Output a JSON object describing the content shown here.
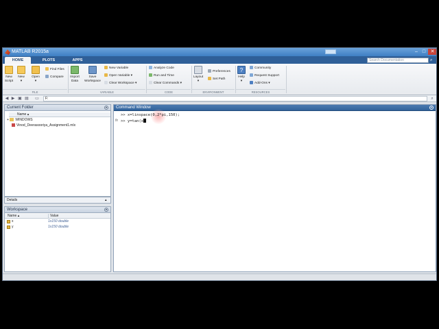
{
  "window": {
    "title": "MATLAB R2015a"
  },
  "tabs": [
    {
      "label": "HOME"
    },
    {
      "label": "PLOTS"
    },
    {
      "label": "APPS"
    }
  ],
  "search": {
    "placeholder": "Search Documentation"
  },
  "ribbon": {
    "file": {
      "group": "FILE",
      "new_script": "New\nScript",
      "new": "New",
      "open": "Open",
      "find_files": "Find Files",
      "compare": "Compare"
    },
    "variable": {
      "group": "VARIABLE",
      "import_data": "Import\nData",
      "save_workspace": "Save\nWorkspace",
      "new_variable": "New Variable",
      "open_variable": "Open Variable",
      "clear_workspace": "Clear Workspace"
    },
    "code": {
      "group": "CODE",
      "analyze_code": "Analyze Code",
      "run_and_time": "Run and Time",
      "clear_commands": "Clear Commands"
    },
    "environment": {
      "group": "ENVIRONMENT",
      "layout": "Layout",
      "preferences": "Preferences",
      "set_path": "Set Path"
    },
    "resources": {
      "group": "RESOURCES",
      "help": "Help",
      "community": "Community",
      "request_support": "Request Support",
      "add_ons": "Add-Ons"
    }
  },
  "address": {
    "path": "F:"
  },
  "current_folder": {
    "title": "Current Folder",
    "column_name": "Name",
    "items": [
      {
        "name": "WINDOWS"
      },
      {
        "name": "Vinod_Deerasooriya_Assignment1.mlx"
      }
    ],
    "details_label": "Details"
  },
  "workspace": {
    "title": "Workspace",
    "columns": {
      "name": "Name",
      "value": "Value"
    },
    "rows": [
      {
        "name": "x",
        "value": "1x150 double"
      },
      {
        "name": "y",
        "value": "1x150 double"
      }
    ]
  },
  "command_window": {
    "title": "Command Window",
    "line1": ">> x=linspace(0,2*pi,150);",
    "line2_prefix": ">> y=tan(x",
    "fx": "fx"
  },
  "colors": {
    "title_blue": "#3f7fc4",
    "tab_bar": "#2f5f98",
    "panel_dark": "#31639b",
    "workspace_value": "#3e5f94"
  }
}
